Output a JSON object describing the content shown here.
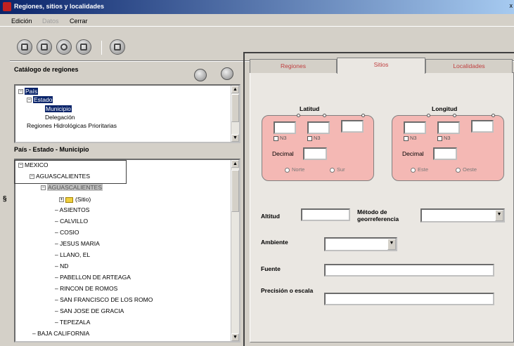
{
  "window": {
    "title": "Regiones, sitios y localidades",
    "close": "x"
  },
  "menu": {
    "items": [
      "Edición",
      "Datos",
      "Cerrar"
    ]
  },
  "catalog": {
    "title": "Catálogo de regiones",
    "tree": [
      {
        "label": "País",
        "state": "selected",
        "expander": "−"
      },
      {
        "label": "Estado",
        "state": "selected",
        "expander": "−"
      },
      {
        "label": "Municipio",
        "state": "selected"
      },
      {
        "label": "Delegación",
        "state": "normal"
      },
      {
        "label": "Regiones Hidrológicas Prioritarias",
        "state": "normal"
      }
    ]
  },
  "hierarchy": {
    "title": "País - Estado - Municipio",
    "tree": [
      {
        "label": "MEXICO",
        "expander": "−"
      },
      {
        "label": "AGUASCALIENTES",
        "expander": "−"
      },
      {
        "label": "AGUASCALIENTES",
        "state": "gray",
        "expander": "−"
      },
      {
        "label": "(Sitio)",
        "expander": "+"
      },
      {
        "label": "ASIENTOS"
      },
      {
        "label": "CALVILLO"
      },
      {
        "label": "COSIO"
      },
      {
        "label": "JESUS MARIA"
      },
      {
        "label": "LLANO, EL"
      },
      {
        "label": "ND"
      },
      {
        "label": "PABELLON DE ARTEAGA"
      },
      {
        "label": "RINCON DE ROMOS"
      },
      {
        "label": "SAN FRANCISCO DE LOS ROMO"
      },
      {
        "label": "SAN JOSE DE GRACIA"
      },
      {
        "label": "TEPEZALA"
      },
      {
        "label": "BAJA CALIFORNIA",
        "expander": "+"
      }
    ]
  },
  "tabs": [
    {
      "label": "Regiones",
      "active": false
    },
    {
      "label": "Sitios",
      "active": true
    },
    {
      "label": "Localidades",
      "active": false
    }
  ],
  "sitios": {
    "latitud": {
      "title": "Latitud",
      "check1": "N3",
      "check2": "N3",
      "decimal": "Decimal",
      "radio1": "Norte",
      "radio2": "Sur"
    },
    "longitud": {
      "title": "Longitud",
      "check1": "N3",
      "check2": "N3",
      "decimal": "Decimal",
      "radio1": "Este",
      "radio2": "Oeste"
    },
    "altitud": "Altitud",
    "metodo": "Método de georreferencia",
    "ambiente": "Ambiente",
    "fuente": "Fuente",
    "precision": "Precisión o escala"
  },
  "colors": {
    "tab_text": "#c04040",
    "selection": "#0a246a",
    "coord_box": "#f4b8b4"
  }
}
